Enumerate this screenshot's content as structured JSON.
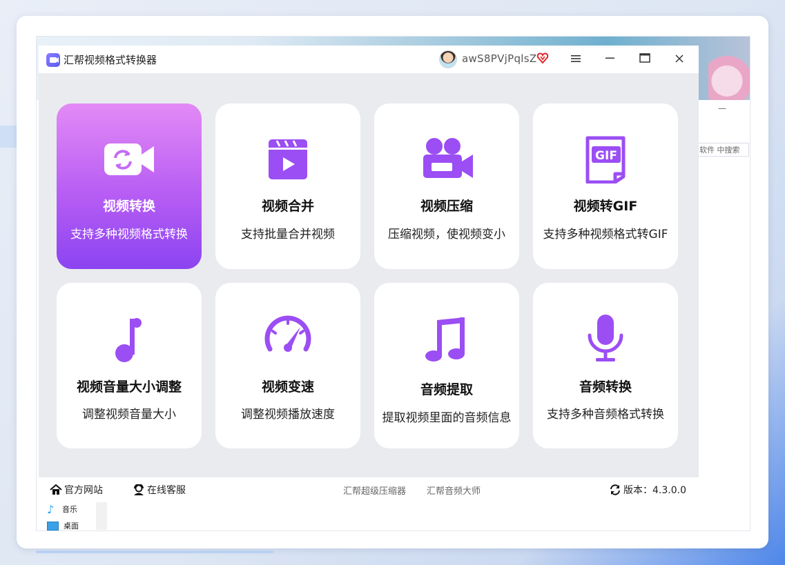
{
  "app": {
    "title": "汇帮视频格式转换器",
    "username": "awS8PVjPqlsZ",
    "accent_color": "#9b4ef3"
  },
  "window_controls": {
    "menu_icon": "hamburger-menu-icon",
    "minimize_icon": "minimize-icon",
    "maximize_icon": "maximize-icon",
    "close_icon": "close-icon"
  },
  "features": [
    {
      "title": "视频转换",
      "desc": "支持多种视频格式转换",
      "icon": "video-convert-icon",
      "active": true
    },
    {
      "title": "视频合并",
      "desc": "支持批量合并视频",
      "icon": "clapperboard-icon",
      "active": false
    },
    {
      "title": "视频压缩",
      "desc": "压缩视频，使视频变小",
      "icon": "video-camera-icon",
      "active": false
    },
    {
      "title": "视频转GIF",
      "desc": "支持多种视频格式转GIF",
      "icon": "gif-file-icon",
      "active": false
    },
    {
      "title": "视频音量大小调整",
      "desc": "调整视频音量大小",
      "icon": "music-note-icon",
      "active": false
    },
    {
      "title": "视频变速",
      "desc": "调整视频播放速度",
      "icon": "speedometer-icon",
      "active": false
    },
    {
      "title": "音频提取",
      "desc": "提取视频里面的音频信息",
      "icon": "double-music-note-icon",
      "active": false
    },
    {
      "title": "音频转换",
      "desc": "支持多种音频格式转换",
      "icon": "microphone-icon",
      "active": false
    }
  ],
  "footer": {
    "website": "官方网站",
    "support": "在线客服",
    "products": [
      "汇帮超级压缩器",
      "汇帮音频大师"
    ],
    "version_label": "版本：4.3.0.0"
  },
  "background_window": {
    "minimize_glyph": "—",
    "search_text": "软件 中搜索",
    "tree_items": [
      "音乐",
      "桌面"
    ]
  }
}
